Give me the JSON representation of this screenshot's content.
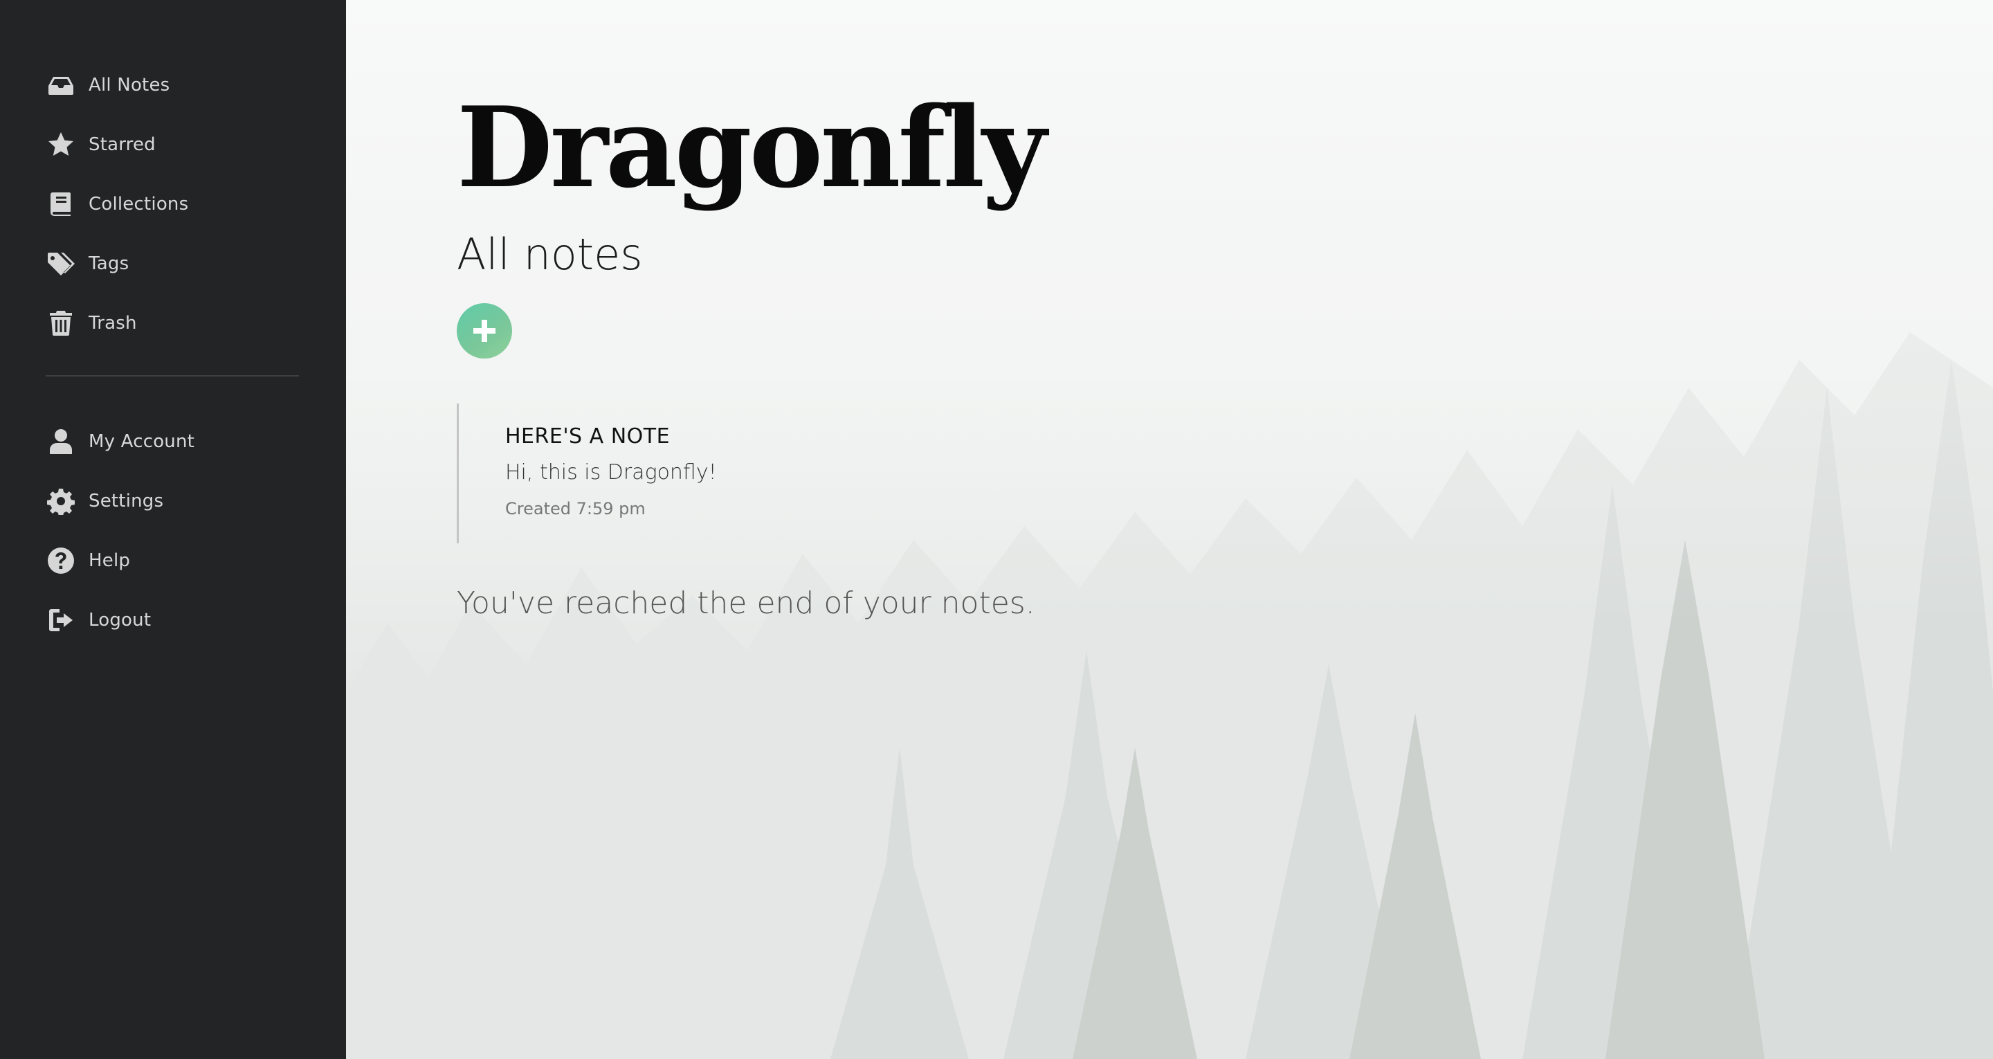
{
  "sidebar": {
    "primary_items": [
      {
        "label": "All Notes",
        "icon": "inbox-icon"
      },
      {
        "label": "Starred",
        "icon": "star-icon"
      },
      {
        "label": "Collections",
        "icon": "book-icon"
      },
      {
        "label": "Tags",
        "icon": "tags-icon"
      },
      {
        "label": "Trash",
        "icon": "trash-icon"
      }
    ],
    "secondary_items": [
      {
        "label": "My Account",
        "icon": "user-icon"
      },
      {
        "label": "Settings",
        "icon": "gear-icon"
      },
      {
        "label": "Help",
        "icon": "question-icon"
      },
      {
        "label": "Logout",
        "icon": "logout-icon"
      }
    ]
  },
  "main": {
    "app_title": "Dragonfly",
    "page_title": "All notes",
    "add_button_icon": "plus-icon",
    "notes": [
      {
        "title": "HERE'S A NOTE",
        "body": "Hi, this is Dragonfly!",
        "created": "Created 7:59 pm"
      }
    ],
    "end_message": "You've reached the end of your notes."
  },
  "colors": {
    "sidebar_bg": "#222425",
    "accent_green": "#6fcaa2"
  }
}
